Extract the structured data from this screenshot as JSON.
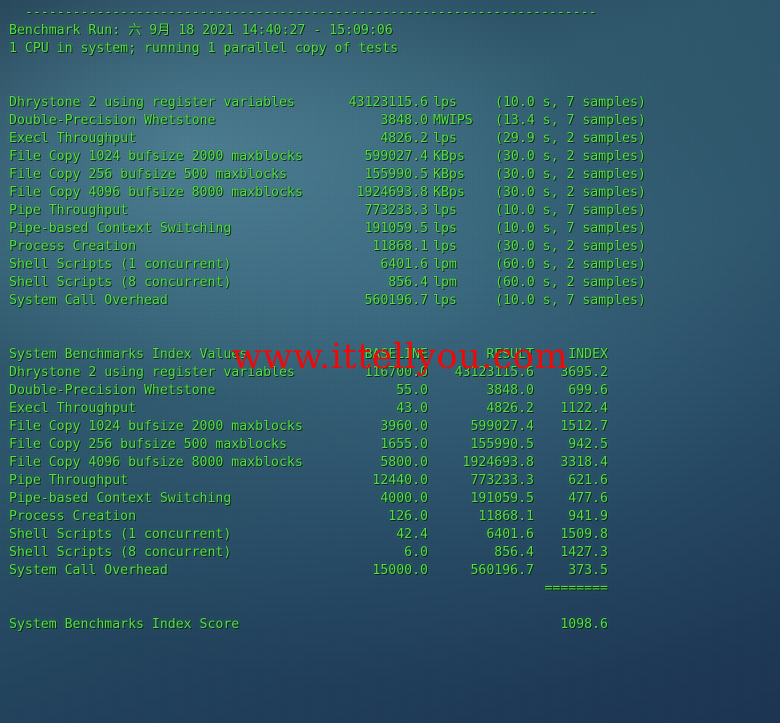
{
  "terminal": {
    "divider_line": "  ------------------------------------------------------------------------",
    "benchmark_run_line": "Benchmark Run: 六 9月 18 2021 14:40:27 - 15:09:06",
    "cpu_line": "1 CPU in system; running 1 parallel copy of tests",
    "text_color": "#55e04a",
    "background_color": "#2d5468"
  },
  "watermark": {
    "text": "www.ittellyou.com",
    "color": "#ef0a0a"
  },
  "raw_results": {
    "rows": [
      {
        "label": "Dhrystone 2 using register variables",
        "value": "43123115.6",
        "unit": "lps",
        "notes": "(10.0 s, 7 samples)"
      },
      {
        "label": "Double-Precision Whetstone",
        "value": "3848.0",
        "unit": "MWIPS",
        "notes": "(13.4 s, 7 samples)"
      },
      {
        "label": "Execl Throughput",
        "value": "4826.2",
        "unit": "lps",
        "notes": "(29.9 s, 2 samples)"
      },
      {
        "label": "File Copy 1024 bufsize 2000 maxblocks",
        "value": "599027.4",
        "unit": "KBps",
        "notes": "(30.0 s, 2 samples)"
      },
      {
        "label": "File Copy 256 bufsize 500 maxblocks",
        "value": "155990.5",
        "unit": "KBps",
        "notes": "(30.0 s, 2 samples)"
      },
      {
        "label": "File Copy 4096 bufsize 8000 maxblocks",
        "value": "1924693.8",
        "unit": "KBps",
        "notes": "(30.0 s, 2 samples)"
      },
      {
        "label": "Pipe Throughput",
        "value": "773233.3",
        "unit": "lps",
        "notes": "(10.0 s, 7 samples)"
      },
      {
        "label": "Pipe-based Context Switching",
        "value": "191059.5",
        "unit": "lps",
        "notes": "(10.0 s, 7 samples)"
      },
      {
        "label": "Process Creation",
        "value": "11868.1",
        "unit": "lps",
        "notes": "(30.0 s, 2 samples)"
      },
      {
        "label": "Shell Scripts (1 concurrent)",
        "value": "6401.6",
        "unit": "lpm",
        "notes": "(60.0 s, 2 samples)"
      },
      {
        "label": "Shell Scripts (8 concurrent)",
        "value": "856.4",
        "unit": "lpm",
        "notes": "(60.0 s, 2 samples)"
      },
      {
        "label": "System Call Overhead",
        "value": "560196.7",
        "unit": "lps",
        "notes": "(10.0 s, 7 samples)"
      }
    ]
  },
  "index_values": {
    "header": {
      "title": "System Benchmarks Index Values",
      "baseline": "BASELINE",
      "result": "RESULT",
      "index": "INDEX"
    },
    "rows": [
      {
        "label": "Dhrystone 2 using register variables",
        "baseline": "116700.0",
        "result": "43123115.6",
        "index": "3695.2"
      },
      {
        "label": "Double-Precision Whetstone",
        "baseline": "55.0",
        "result": "3848.0",
        "index": "699.6"
      },
      {
        "label": "Execl Throughput",
        "baseline": "43.0",
        "result": "4826.2",
        "index": "1122.4"
      },
      {
        "label": "File Copy 1024 bufsize 2000 maxblocks",
        "baseline": "3960.0",
        "result": "599027.4",
        "index": "1512.7"
      },
      {
        "label": "File Copy 256 bufsize 500 maxblocks",
        "baseline": "1655.0",
        "result": "155990.5",
        "index": "942.5"
      },
      {
        "label": "File Copy 4096 bufsize 8000 maxblocks",
        "baseline": "5800.0",
        "result": "1924693.8",
        "index": "3318.4"
      },
      {
        "label": "Pipe Throughput",
        "baseline": "12440.0",
        "result": "773233.3",
        "index": "621.6"
      },
      {
        "label": "Pipe-based Context Switching",
        "baseline": "4000.0",
        "result": "191059.5",
        "index": "477.6"
      },
      {
        "label": "Process Creation",
        "baseline": "126.0",
        "result": "11868.1",
        "index": "941.9"
      },
      {
        "label": "Shell Scripts (1 concurrent)",
        "baseline": "42.4",
        "result": "6401.6",
        "index": "1509.8"
      },
      {
        "label": "Shell Scripts (8 concurrent)",
        "baseline": "6.0",
        "result": "856.4",
        "index": "1427.3"
      },
      {
        "label": "System Call Overhead",
        "baseline": "15000.0",
        "result": "560196.7",
        "index": "373.5"
      }
    ],
    "separator": "========",
    "score_label": "System Benchmarks Index Score",
    "score_value": "1098.6"
  }
}
